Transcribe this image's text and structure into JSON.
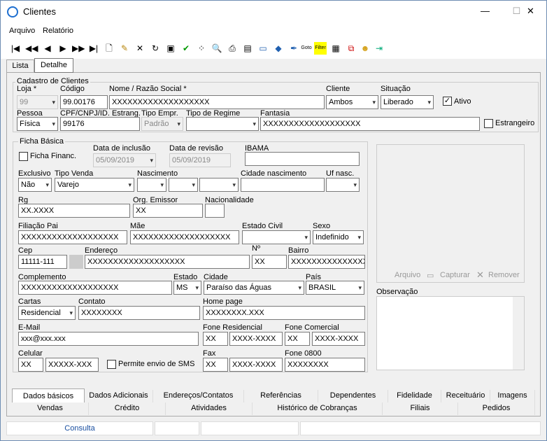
{
  "window": {
    "title": "Clientes",
    "min": "—",
    "max": "☐",
    "close": "✕"
  },
  "menu": {
    "arquivo": "Arquivo",
    "relatorio": "Relatório"
  },
  "tabs": {
    "lista": "Lista",
    "detalhe": "Detalhe"
  },
  "cadastro": {
    "legend": "Cadastro de Clientes",
    "loja_label": "Loja *",
    "loja": "99",
    "codigo_label": "Código",
    "codigo": "99.00176",
    "nome_label": "Nome / Razão Social *",
    "nome": "XXXXXXXXXXXXXXXXXXX",
    "cliente_label": "Cliente",
    "cliente": "Ambos",
    "situacao_label": "Situação",
    "situacao": "Liberado",
    "ativo_label": "Ativo",
    "pessoa_label": "Pessoa",
    "pessoa": "Física",
    "cpf_label": "CPF/CNPJ/ID. Estrang.",
    "cpf": "99176",
    "tipo_empr_label": "Tipo Empr.",
    "tipo_empr": "Padrão",
    "regime_label": "Tipo de Regime",
    "regime": "",
    "fantasia_label": "Fantasia",
    "fantasia": "XXXXXXXXXXXXXXXXXXX",
    "estrangeiro_label": "Estrangeiro"
  },
  "ficha": {
    "legend": "Ficha Básica",
    "financ_label": "Ficha Financ.",
    "inclusao_label": "Data de inclusão",
    "inclusao": "05/09/2019",
    "revisao_label": "Data de revisão",
    "revisao": "05/09/2019",
    "ibama_label": "IBAMA",
    "ibama": "",
    "exclusivo_label": "Exclusivo",
    "exclusivo": "Não",
    "tipo_venda_label": "Tipo Venda",
    "tipo_venda": "Varejo",
    "nascimento_label": "Nascimento",
    "cidade_nasc_label": "Cidade nascimento",
    "cidade_nasc": "",
    "uf_nasc_label": "Uf nasc.",
    "rg_label": "Rg",
    "rg": "XX.XXXX",
    "orgao_label": "Org. Emissor",
    "orgao": "XX",
    "nacionalidade_label": "Nacionalidade",
    "nacionalidade": "",
    "filiacao_label": "Filiação  Pai",
    "pai": "XXXXXXXXXXXXXXXXXXX",
    "mae_label": "Mãe",
    "mae": "XXXXXXXXXXXXXXXXXXX",
    "civil_label": "Estado Civil",
    "civil": "",
    "sexo_label": "Sexo",
    "sexo": "Indefinido",
    "cep_label": "Cep",
    "cep": "11111-111",
    "endereco_label": "Endereço",
    "endereco": "XXXXXXXXXXXXXXXXXXX",
    "numero_label": "Nº",
    "numero": "XX",
    "bairro_label": "Bairro",
    "bairro": "XXXXXXXXXXXXXXXXXXX",
    "complemento_label": "Complemento",
    "complemento": "XXXXXXXXXXXXXXXXXXX",
    "estado_label": "Estado",
    "estado": "MS",
    "cidade_label": "Cidade",
    "cidade": "Paraíso das Águas",
    "pais_label": "País",
    "pais": "BRASIL",
    "cartas_label": "Cartas",
    "cartas": "Residencial",
    "contato_label": "Contato",
    "contato": "XXXXXXXX",
    "homepage_label": "Home page",
    "homepage": "XXXXXXXX.XXX",
    "email_label": "E-Mail",
    "email": "xxx@xxx.xxx",
    "fone_res_label": "Fone Residencial",
    "fone_res_ddd": "XX",
    "fone_res": "XXXX-XXXX",
    "fone_com_label": "Fone Comercial",
    "fone_com_ddd": "XX",
    "fone_com": "XXXX-XXXX",
    "celular_label": "Celular",
    "celular_ddd": "XX",
    "celular": "XXXXX-XXX",
    "sms_label": "Permite envio de SMS",
    "fax_label": "Fax",
    "fax_ddd": "XX",
    "fax": "XXXX-XXXX",
    "fone0800_label": "Fone 0800",
    "fone0800": "XXXXXXXX"
  },
  "image": {
    "arquivo": "Arquivo",
    "capturar": "Capturar",
    "remover": "Remover"
  },
  "obs_label": "Observação",
  "bottom_tabs_row1": [
    "Dados básicos",
    "Dados Adicionais",
    "Endereços/Contatos",
    "Referências",
    "Dependentes",
    "Fidelidade",
    "Receituário",
    "Imagens"
  ],
  "bottom_tabs_row2": [
    "Vendas",
    "Crédito",
    "Atividades",
    "Histórico de Cobranças",
    "Filiais",
    "Pedidos"
  ],
  "status": {
    "consulta": "Consulta"
  }
}
